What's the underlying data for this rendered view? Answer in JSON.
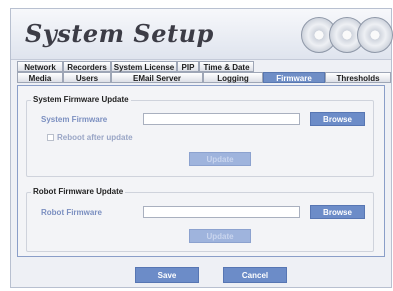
{
  "header": {
    "title": "System Setup"
  },
  "tabs": {
    "row1": [
      "Network",
      "Recorders",
      "System License",
      "PIP",
      "Time & Date"
    ],
    "row2": [
      "Media",
      "Users",
      "EMail Server",
      "Logging",
      "Firmware",
      "Thresholds"
    ],
    "active": "Firmware"
  },
  "system_firmware": {
    "group_title": "System Firmware Update",
    "field_label": "System Firmware",
    "value": "",
    "browse_label": "Browse",
    "reboot_label": "Reboot after update",
    "reboot_checked": false,
    "update_label": "Update"
  },
  "robot_firmware": {
    "group_title": "Robot Firmware Update",
    "field_label": "Robot Firmware",
    "value": "",
    "browse_label": "Browse",
    "update_label": "Update"
  },
  "footer": {
    "save_label": "Save",
    "cancel_label": "Cancel"
  }
}
